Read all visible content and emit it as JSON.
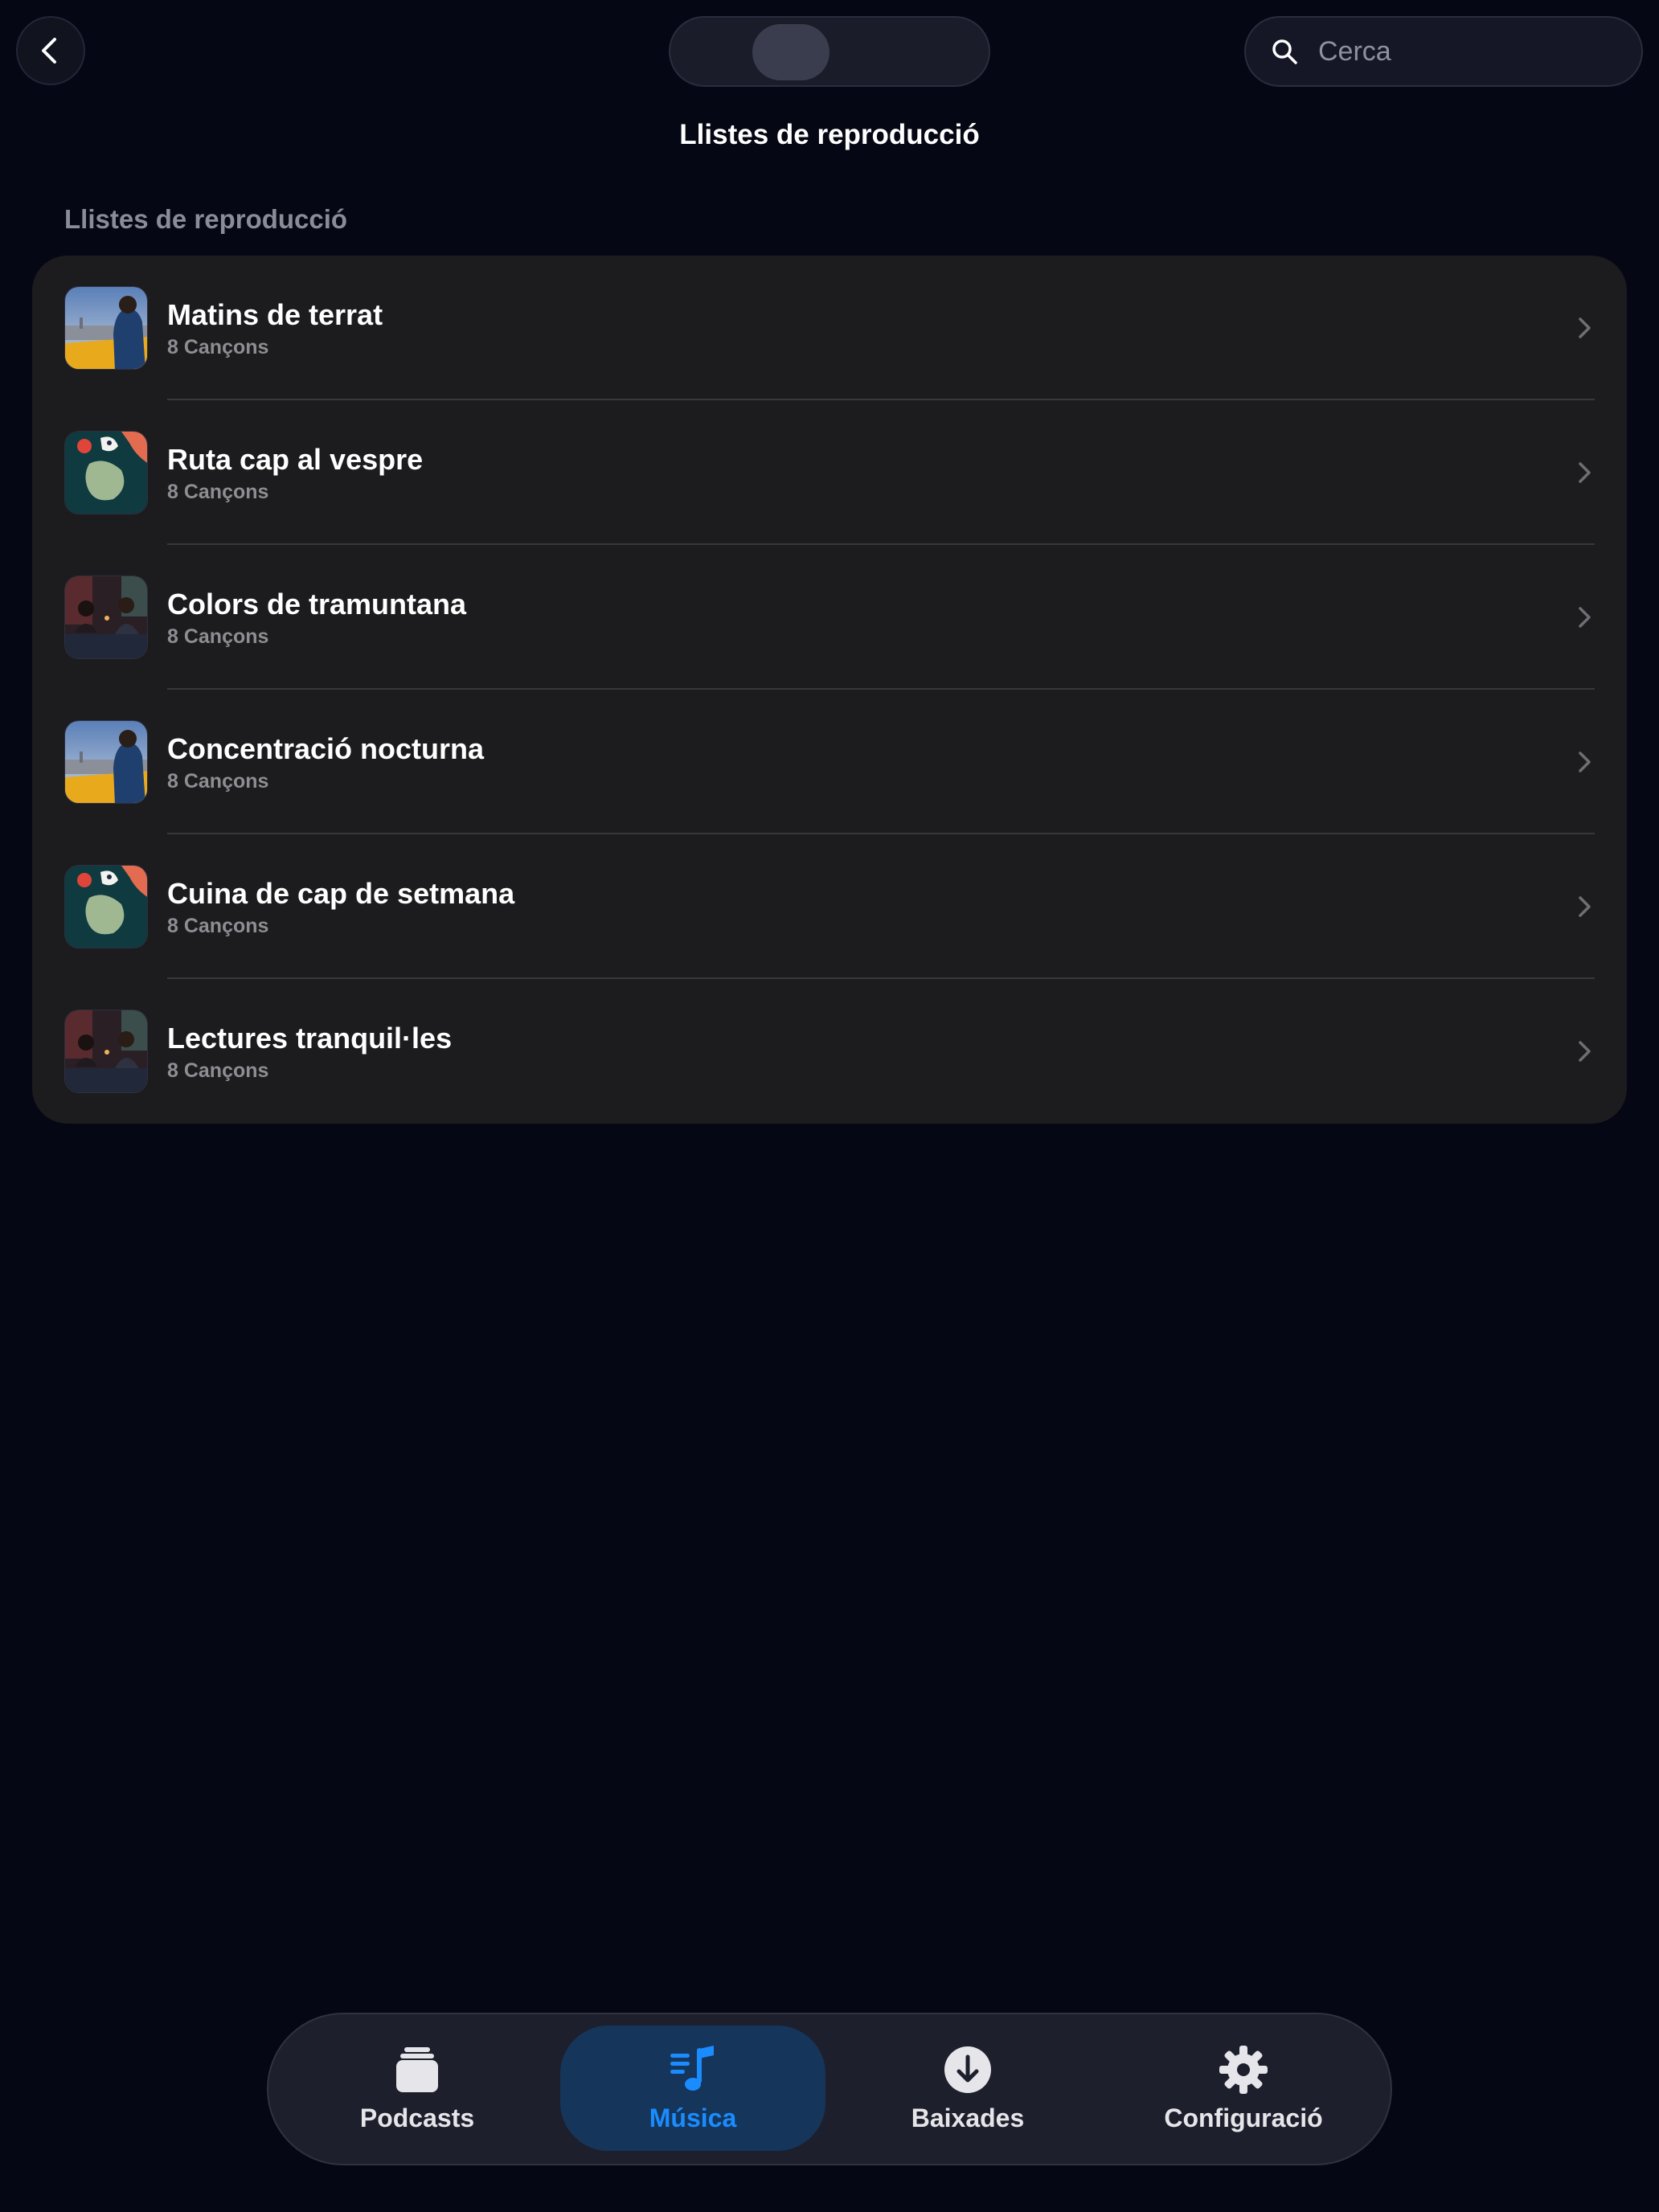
{
  "header": {
    "back_icon": "chevron-left-icon",
    "title": "Llistes de reproducció",
    "search": {
      "placeholder": "Cerca",
      "icon": "search-icon"
    }
  },
  "section": {
    "title": "Llistes de reproducció"
  },
  "playlists": [
    {
      "title": "Matins de terrat",
      "subtitle": "8 Cançons",
      "artwork": "rooftop-artwork"
    },
    {
      "title": "Ruta cap al vespre",
      "subtitle": "8 Cançons",
      "artwork": "abstract-artwork"
    },
    {
      "title": "Colors de tramuntana",
      "subtitle": "8 Cançons",
      "artwork": "dinner-artwork"
    },
    {
      "title": "Concentració nocturna",
      "subtitle": "8 Cançons",
      "artwork": "rooftop-artwork"
    },
    {
      "title": "Cuina de cap de setmana",
      "subtitle": "8 Cançons",
      "artwork": "abstract-artwork"
    },
    {
      "title": "Lectures tranquil·les",
      "subtitle": "8 Cançons",
      "artwork": "dinner-artwork"
    }
  ],
  "tabbar": {
    "tabs": [
      {
        "label": "Podcasts",
        "icon": "stack-icon",
        "active": false
      },
      {
        "label": "Música",
        "icon": "music-list-icon",
        "active": true
      },
      {
        "label": "Baixades",
        "icon": "download-icon",
        "active": false
      },
      {
        "label": "Configuració",
        "icon": "gear-icon",
        "active": false
      }
    ]
  },
  "colors": {
    "background": "#050714",
    "card": "#1c1c1e",
    "accent": "#1a8cff",
    "active_tab_bg": "#15365a"
  }
}
